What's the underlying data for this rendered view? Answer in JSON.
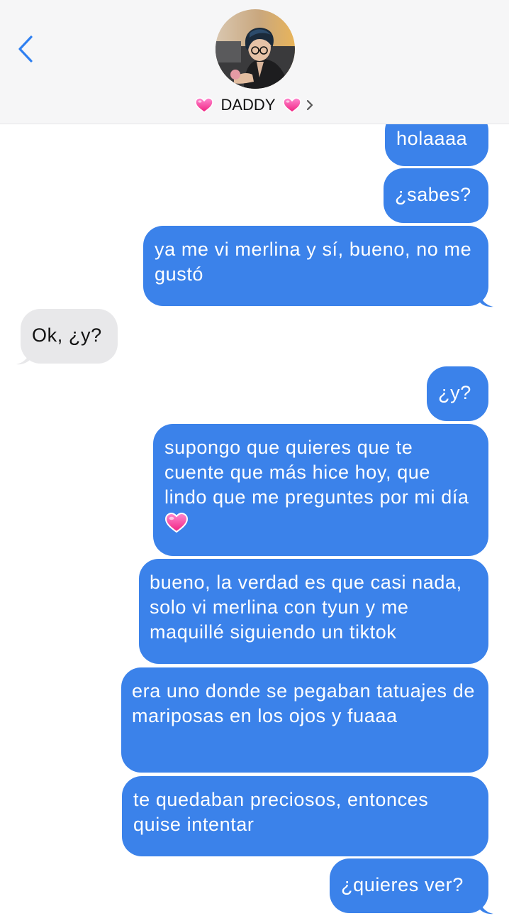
{
  "header": {
    "contact_name": "DADDY",
    "name_decor_icon": "pink-heart-emoji",
    "back_icon": "chevron-left-icon",
    "accent_color": "#2f80f1"
  },
  "colors": {
    "sent_bubble": "#3b82ea",
    "received_bubble": "#e8e8ea",
    "header_bg": "#f6f6f7"
  },
  "messages": [
    {
      "direction": "sent",
      "text": "holaaaa"
    },
    {
      "direction": "sent",
      "text": "¿sabes?"
    },
    {
      "direction": "sent",
      "text": "ya me vi merlina y sí, bueno, no me gustó"
    },
    {
      "direction": "received",
      "text": "Ok, ¿y?"
    },
    {
      "direction": "sent",
      "text": "¿y?"
    },
    {
      "direction": "sent",
      "text": "supongo que quieres que te cuente que más hice hoy, que lindo que me preguntes por mi día",
      "emoji": "pink-heart-emoji"
    },
    {
      "direction": "sent",
      "text": "bueno, la verdad es que casi nada, solo vi merlina con tyun y me maquillé siguiendo un tiktok"
    },
    {
      "direction": "sent",
      "text": "era uno donde se pegaban tatuajes de mariposas en los ojos y fuaaa"
    },
    {
      "direction": "sent",
      "text": "te quedaban preciosos, entonces quise intentar"
    },
    {
      "direction": "sent",
      "text": "¿quieres ver?"
    }
  ]
}
